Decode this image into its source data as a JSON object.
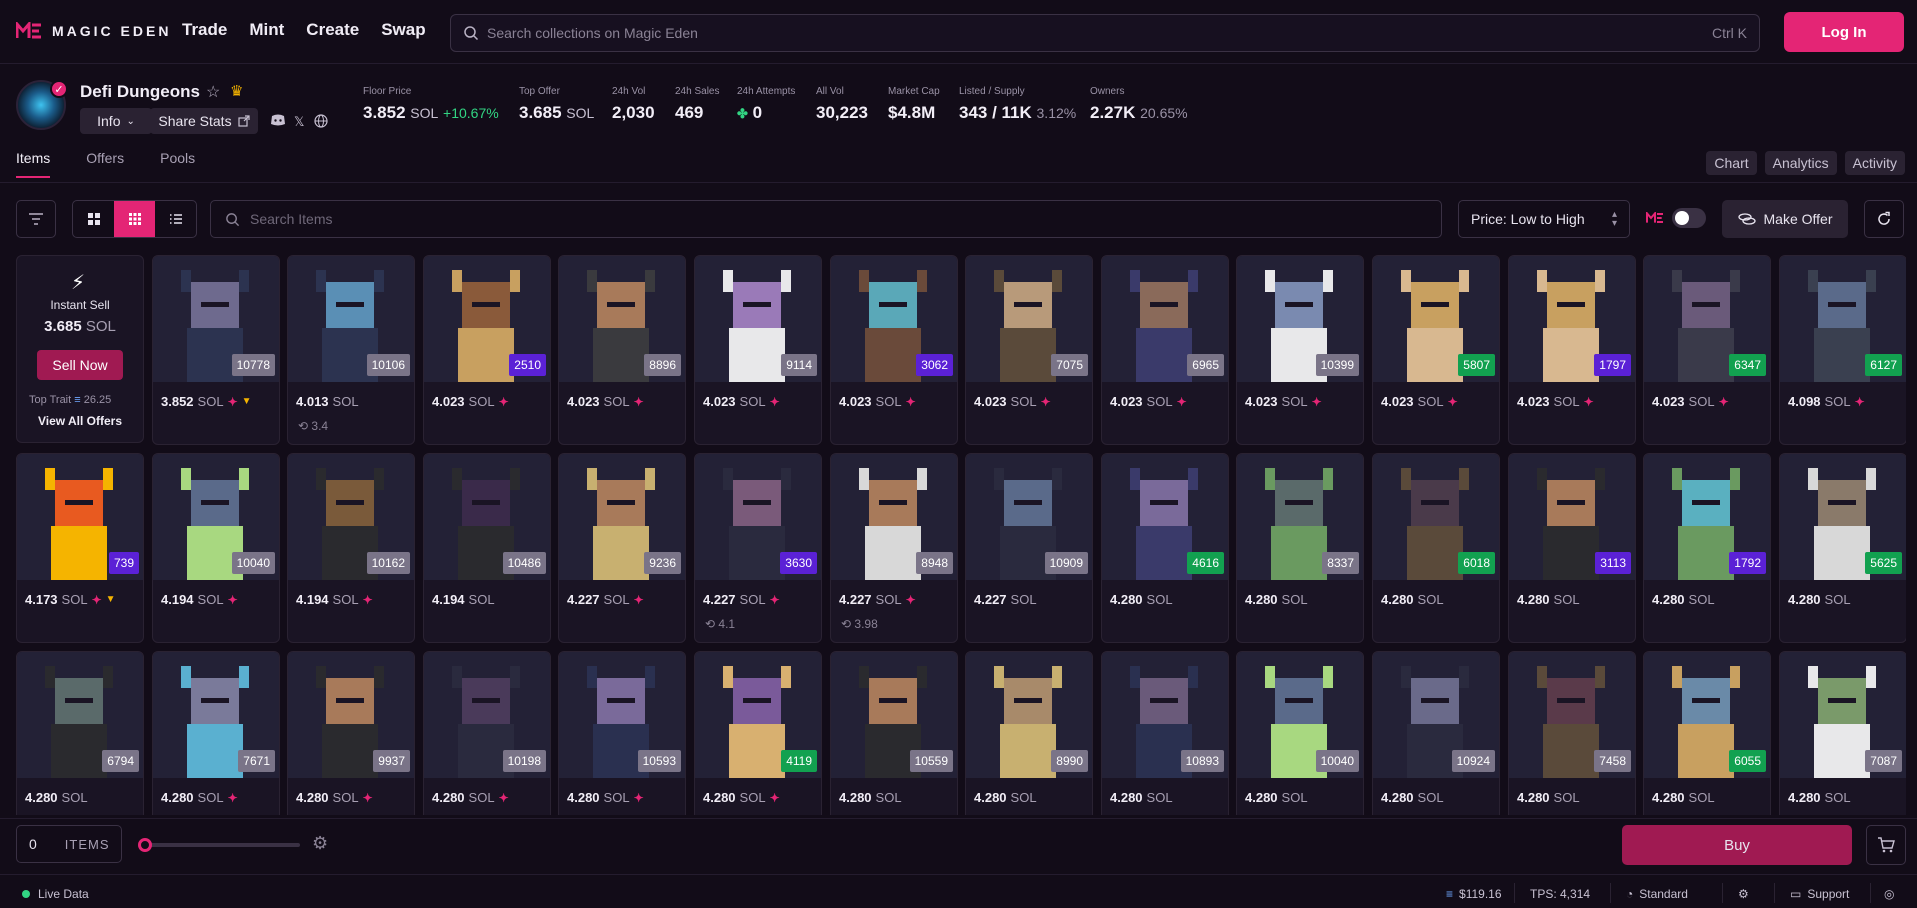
{
  "brand": {
    "name": "MAGIC EDEN",
    "accent": "#e42575"
  },
  "nav": {
    "links": [
      "Trade",
      "Mint",
      "Create",
      "Swap"
    ],
    "login": "Log In"
  },
  "search": {
    "placeholder": "Search collections on Magic Eden",
    "shortcut": "Ctrl K"
  },
  "collection": {
    "name": "Defi Dungeons",
    "info": "Info",
    "share": "Share Stats"
  },
  "stats": [
    {
      "label": "Floor Price",
      "value": "3.852",
      "unit": "SOL",
      "extra": "+10.67%",
      "extra_type": "pos"
    },
    {
      "label": "Top Offer",
      "value": "3.685",
      "unit": "SOL",
      "extra": "",
      "extra_type": ""
    },
    {
      "label": "24h Vol",
      "value": "2,030",
      "unit": "",
      "extra": "",
      "extra_type": ""
    },
    {
      "label": "24h Sales",
      "value": "469",
      "unit": "",
      "extra": "",
      "extra_type": ""
    },
    {
      "label": "24h Attempts",
      "value": "0",
      "unit": "",
      "extra": "",
      "extra_type": ""
    },
    {
      "label": "All Vol",
      "value": "30,223",
      "unit": "",
      "extra": "",
      "extra_type": ""
    },
    {
      "label": "Market Cap",
      "value": "$4.8M",
      "unit": "",
      "extra": "",
      "extra_type": ""
    },
    {
      "label": "Listed / Supply",
      "value": "343 / 11K",
      "unit": "",
      "extra": "3.12%",
      "extra_type": "mut"
    },
    {
      "label": "Owners",
      "value": "2.27K",
      "unit": "",
      "extra": "20.65%",
      "extra_type": "mut"
    }
  ],
  "tabs": [
    "Items",
    "Offers",
    "Pools"
  ],
  "right_tabs": [
    "Chart",
    "Analytics",
    "Activity"
  ],
  "toolbar": {
    "search_placeholder": "Search Items",
    "sort": "Price: Low to High",
    "make_offer": "Make Offer"
  },
  "instant_sell": {
    "title": "Instant Sell",
    "price": "3.685",
    "unit": "SOL",
    "button": "Sell Now",
    "top_trait_label": "Top Trait",
    "top_trait_value": "26.25",
    "view_all": "View All Offers"
  },
  "items": [
    {
      "id": "10778",
      "price": "3.852",
      "spark": true,
      "tri": true,
      "lp": "",
      "badge": "gray",
      "skin": "#6e6a8e",
      "hair": "#2c3350"
    },
    {
      "id": "10106",
      "price": "4.013",
      "spark": false,
      "tri": false,
      "lp": "3.4",
      "badge": "gray",
      "skin": "#5a8fb5",
      "hair": "#2c3350"
    },
    {
      "id": "2510",
      "price": "4.023",
      "spark": true,
      "tri": false,
      "lp": "",
      "badge": "purple",
      "skin": "#8a5a3a",
      "hair": "#c8a060"
    },
    {
      "id": "8896",
      "price": "4.023",
      "spark": true,
      "tri": false,
      "lp": "",
      "badge": "gray",
      "skin": "#a87a5a",
      "hair": "#3a3a3e"
    },
    {
      "id": "9114",
      "price": "4.023",
      "spark": true,
      "tri": false,
      "lp": "",
      "badge": "gray",
      "skin": "#9a7ab8",
      "hair": "#e8e8ea"
    },
    {
      "id": "3062",
      "price": "4.023",
      "spark": true,
      "tri": false,
      "lp": "",
      "badge": "purple",
      "skin": "#5aa8b8",
      "hair": "#6a4a3a"
    },
    {
      "id": "7075",
      "price": "4.023",
      "spark": true,
      "tri": false,
      "lp": "",
      "badge": "gray",
      "skin": "#b89a7a",
      "hair": "#5a4a3a"
    },
    {
      "id": "6965",
      "price": "4.023",
      "spark": true,
      "tri": false,
      "lp": "",
      "badge": "gray",
      "skin": "#8a6a5a",
      "hair": "#3a3a6a"
    },
    {
      "id": "10399",
      "price": "4.023",
      "spark": true,
      "tri": false,
      "lp": "",
      "badge": "gray",
      "skin": "#7a8ab0",
      "hair": "#e8e8ea"
    },
    {
      "id": "5807",
      "price": "4.023",
      "spark": true,
      "tri": false,
      "lp": "",
      "badge": "green",
      "skin": "#c8a060",
      "hair": "#d8b890"
    },
    {
      "id": "1797",
      "price": "4.023",
      "spark": true,
      "tri": false,
      "lp": "",
      "badge": "purple",
      "skin": "#c8a060",
      "hair": "#d8b890"
    },
    {
      "id": "6347",
      "price": "4.023",
      "spark": true,
      "tri": false,
      "lp": "",
      "badge": "green",
      "skin": "#6a5a7a",
      "hair": "#3a3a4a"
    },
    {
      "id": "6127",
      "price": "4.098",
      "spark": true,
      "tri": false,
      "lp": "",
      "badge": "green",
      "skin": "#5a6a8a",
      "hair": "#3a4050"
    },
    {
      "id": "739",
      "price": "4.173",
      "spark": true,
      "tri": true,
      "lp": "",
      "badge": "purple",
      "skin": "#e85a20",
      "hair": "#f5b400"
    },
    {
      "id": "10040",
      "price": "4.194",
      "spark": true,
      "tri": false,
      "lp": "",
      "badge": "gray",
      "skin": "#5a6a8a",
      "hair": "#a8d880"
    },
    {
      "id": "10162",
      "price": "4.194",
      "spark": true,
      "tri": false,
      "lp": "",
      "badge": "gray",
      "skin": "#7a5a3a",
      "hair": "#2a2a2e"
    },
    {
      "id": "10486",
      "price": "4.194",
      "spark": false,
      "tri": false,
      "lp": "",
      "badge": "gray",
      "skin": "#3a2a4a",
      "hair": "#2a2a2e"
    },
    {
      "id": "9236",
      "price": "4.227",
      "spark": true,
      "tri": false,
      "lp": "",
      "badge": "gray",
      "skin": "#a87a5a",
      "hair": "#c8b070"
    },
    {
      "id": "3630",
      "price": "4.227",
      "spark": true,
      "tri": false,
      "lp": "4.1",
      "badge": "purple",
      "skin": "#7a5a7a",
      "hair": "#2a2a3e"
    },
    {
      "id": "8948",
      "price": "4.227",
      "spark": true,
      "tri": false,
      "lp": "3.98",
      "badge": "gray",
      "skin": "#a87a5a",
      "hair": "#d8d8d8"
    },
    {
      "id": "10909",
      "price": "4.227",
      "spark": false,
      "tri": false,
      "lp": "",
      "badge": "gray",
      "skin": "#5a6a8a",
      "hair": "#2a2a3e"
    },
    {
      "id": "4616",
      "price": "4.280",
      "spark": false,
      "tri": false,
      "lp": "",
      "badge": "green",
      "skin": "#7a6a9a",
      "hair": "#3a3a6a"
    },
    {
      "id": "8337",
      "price": "4.280",
      "spark": false,
      "tri": false,
      "lp": "",
      "badge": "gray",
      "skin": "#5a6a6a",
      "hair": "#6a9a60"
    },
    {
      "id": "6018",
      "price": "4.280",
      "spark": false,
      "tri": false,
      "lp": "",
      "badge": "green",
      "skin": "#4a3a4a",
      "hair": "#5a4a3a"
    },
    {
      "id": "3113",
      "price": "4.280",
      "spark": false,
      "tri": false,
      "lp": "",
      "badge": "purple",
      "skin": "#a87a5a",
      "hair": "#2a2a2e"
    },
    {
      "id": "1792",
      "price": "4.280",
      "spark": false,
      "tri": false,
      "lp": "",
      "badge": "purple",
      "skin": "#5ab0c0",
      "hair": "#6a9a60"
    },
    {
      "id": "5625",
      "price": "4.280",
      "spark": false,
      "tri": false,
      "lp": "",
      "badge": "green",
      "skin": "#8a7a6a",
      "hair": "#d8d8d8"
    },
    {
      "id": "6794",
      "price": "4.280",
      "spark": false,
      "tri": false,
      "lp": "",
      "badge": "gray",
      "skin": "#5a6a6a",
      "hair": "#2a2a2e"
    },
    {
      "id": "7671",
      "price": "4.280",
      "spark": true,
      "tri": false,
      "lp": "",
      "badge": "gray",
      "skin": "#7a7a9a",
      "hair": "#5ab0d0"
    },
    {
      "id": "9937",
      "price": "4.280",
      "spark": true,
      "tri": false,
      "lp": "",
      "badge": "gray",
      "skin": "#a87a5a",
      "hair": "#2a2a2e"
    },
    {
      "id": "10198",
      "price": "4.280",
      "spark": true,
      "tri": false,
      "lp": "",
      "badge": "gray",
      "skin": "#4a3a5a",
      "hair": "#2a2a3e"
    },
    {
      "id": "10593",
      "price": "4.280",
      "spark": true,
      "tri": false,
      "lp": "",
      "badge": "gray",
      "skin": "#7a6a9a",
      "hair": "#2a3050"
    },
    {
      "id": "4119",
      "price": "4.280",
      "spark": true,
      "tri": false,
      "lp": "",
      "badge": "green",
      "skin": "#7a5a9a",
      "hair": "#d8b070"
    },
    {
      "id": "10559",
      "price": "4.280",
      "spark": false,
      "tri": false,
      "lp": "",
      "badge": "gray",
      "skin": "#a87a5a",
      "hair": "#2a2a2e"
    },
    {
      "id": "8990",
      "price": "4.280",
      "spark": false,
      "tri": false,
      "lp": "",
      "badge": "gray",
      "skin": "#a88a6a",
      "hair": "#c8b070"
    },
    {
      "id": "10893",
      "price": "4.280",
      "spark": false,
      "tri": false,
      "lp": "",
      "badge": "gray",
      "skin": "#6a5a7a",
      "hair": "#2a3050"
    },
    {
      "id": "10040",
      "price": "4.280",
      "spark": false,
      "tri": false,
      "lp": "",
      "badge": "gray",
      "skin": "#5a6a8a",
      "hair": "#a8d880"
    },
    {
      "id": "10924",
      "price": "4.280",
      "spark": false,
      "tri": false,
      "lp": "",
      "badge": "gray",
      "skin": "#6a6a8a",
      "hair": "#2a2a3e"
    },
    {
      "id": "7458",
      "price": "4.280",
      "spark": false,
      "tri": false,
      "lp": "",
      "badge": "gray",
      "skin": "#5a3a4a",
      "hair": "#5a4a3a"
    },
    {
      "id": "6055",
      "price": "4.280",
      "spark": false,
      "tri": false,
      "lp": "",
      "badge": "green",
      "skin": "#6a8aa8",
      "hair": "#c8a060"
    },
    {
      "id": "7087",
      "price": "4.280",
      "spark": false,
      "tri": false,
      "lp": "",
      "badge": "gray",
      "skin": "#7a9a6a",
      "hair": "#e8e8ea"
    }
  ],
  "currency": "SOL",
  "badge_colors": {
    "gray": "#7a7488",
    "purple": "#5b21d6",
    "green": "#12a150"
  },
  "bottom": {
    "count": "0",
    "items_label": "ITEMS",
    "buy": "Buy"
  },
  "status": {
    "live": "Live Data",
    "price": "$119.16",
    "tps": "TPS: 4,314",
    "mode": "Standard",
    "support": "Support"
  }
}
